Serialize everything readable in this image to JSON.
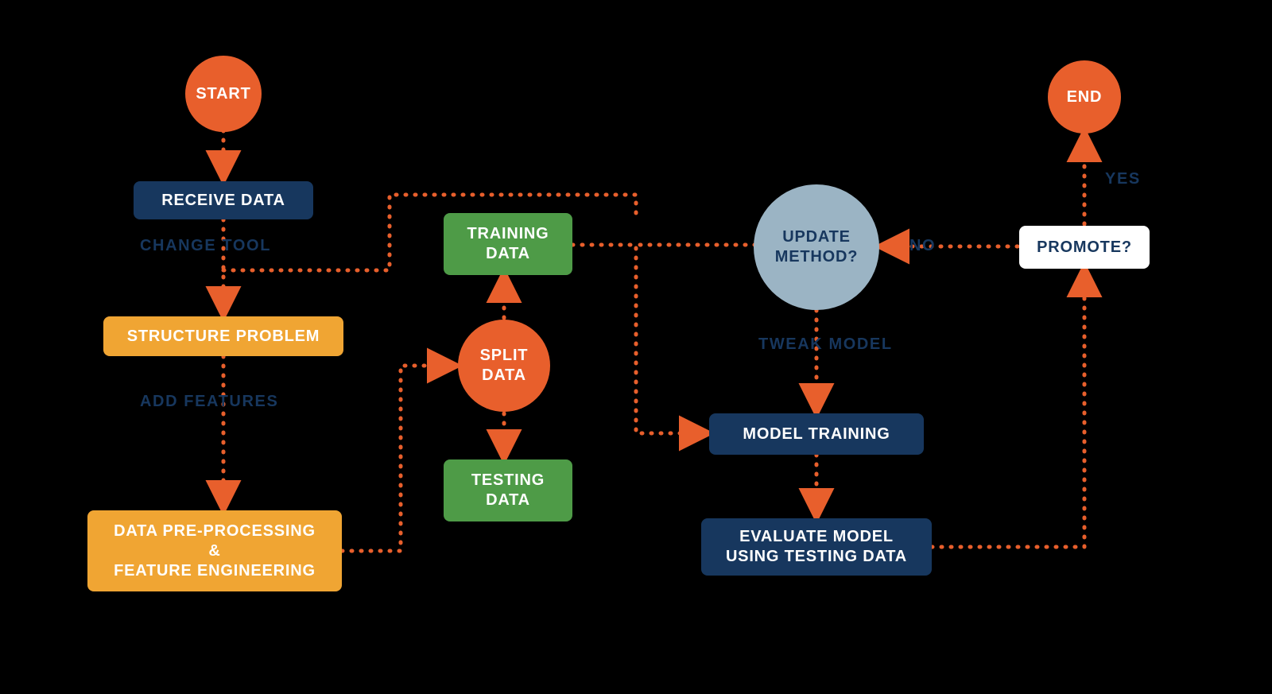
{
  "nodes": {
    "start": "START",
    "receive_data": "RECEIVE DATA",
    "structure_problem": "STRUCTURE PROBLEM",
    "preprocessing": "DATA PRE-PROCESSING\n&\nFEATURE ENGINEERING",
    "training_data": "TRAINING\nDATA",
    "split_data": "SPLIT\nDATA",
    "testing_data": "TESTING\nDATA",
    "model_training": "MODEL TRAINING",
    "evaluate": "EVALUATE MODEL\nUSING TESTING DATA",
    "update_method": "UPDATE\nMETHOD?",
    "promote": "PROMOTE?",
    "end": "END"
  },
  "labels": {
    "change_tool": "CHANGE TOOL",
    "add_features": "ADD FEATURES",
    "tweak_model": "TWEAK MODEL",
    "no": "NO",
    "yes": "YES"
  },
  "colors": {
    "orange": "#E85F2C",
    "navy": "#17375E",
    "amber": "#F0A533",
    "green": "#4E9B47",
    "steel": "#9BB4C4",
    "white": "#FFFFFF",
    "arrow": "#E85F2C"
  }
}
